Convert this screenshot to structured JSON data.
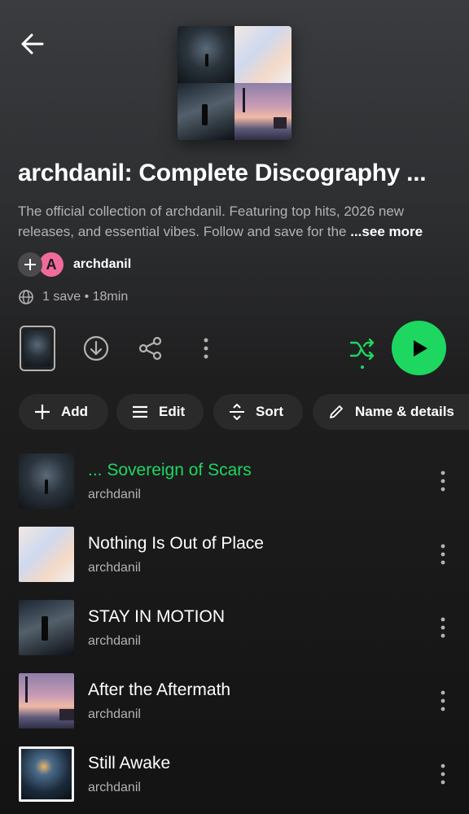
{
  "header": {
    "back_icon": "arrow-left-icon"
  },
  "playlist": {
    "title": "archdanil: Complete Discography ...",
    "description": "The official collection of archdanil. Featuring top hits, 2026 new releases, and essential vibes. Follow and save for the ",
    "see_more": "...see more",
    "owner_initial": "A",
    "owner_name": "archdanil",
    "meta": "1 save • 18min"
  },
  "colors": {
    "accent": "#1ed760",
    "avatar": "#f06b9c",
    "secondary_text": "#b3b3b3"
  },
  "actions": {
    "download_icon": "download-icon",
    "share_icon": "share-icon",
    "more_icon": "more-vertical-icon",
    "shuffle_icon": "shuffle-icon",
    "play_icon": "play-icon"
  },
  "chips": [
    {
      "label": "Add",
      "icon": "plus-icon"
    },
    {
      "label": "Edit",
      "icon": "menu-icon"
    },
    {
      "label": "Sort",
      "icon": "sort-icon"
    },
    {
      "label": "Name & details",
      "icon": "pencil-icon"
    }
  ],
  "tracks": [
    {
      "title": "... Sovereign of Scars",
      "artist": "archdanil",
      "playing": true
    },
    {
      "title": "Nothing Is Out of Place",
      "artist": "archdanil",
      "playing": false
    },
    {
      "title": "STAY IN MOTION",
      "artist": "archdanil",
      "playing": false
    },
    {
      "title": "After the Aftermath",
      "artist": "archdanil",
      "playing": false
    },
    {
      "title": "Still Awake",
      "artist": "archdanil",
      "playing": false
    }
  ]
}
